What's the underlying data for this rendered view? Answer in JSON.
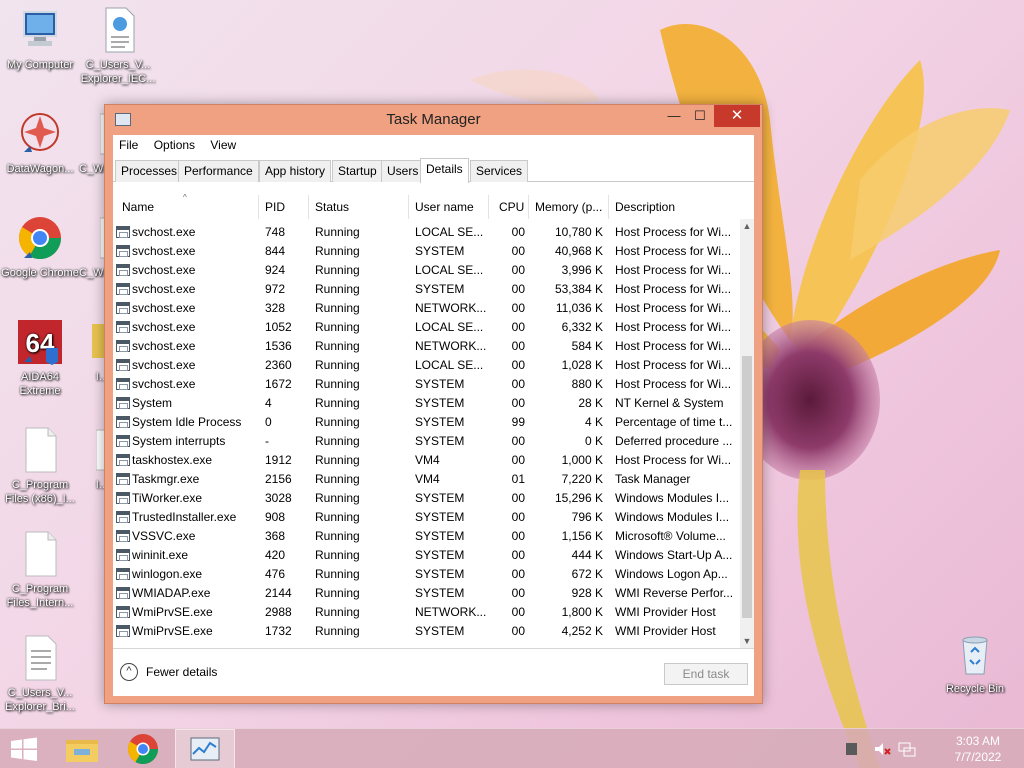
{
  "desktop": {
    "icons": [
      {
        "label": "My Computer"
      },
      {
        "label": "C_Users_V... Explorer_IEC..."
      },
      {
        "label": "DataWagon..."
      },
      {
        "label": "C_W..."
      },
      {
        "label": "Google Chrome"
      },
      {
        "label": "C_W..."
      },
      {
        "label": "AIDA64 Extreme"
      },
      {
        "label": "I..."
      },
      {
        "label": "C_Program Files (x86)_I..."
      },
      {
        "label": "I..."
      },
      {
        "label": "C_Program Files_Intern..."
      },
      {
        "label": "C_Users_V... Explorer_Bri..."
      },
      {
        "label": "Recycle Bin"
      }
    ]
  },
  "window": {
    "title": "Task Manager",
    "min_glyph": "—",
    "max_glyph": "☐",
    "close_glyph": "✕"
  },
  "menu": [
    "File",
    "Options",
    "View"
  ],
  "tabs": [
    "Processes",
    "Performance",
    "App history",
    "Startup",
    "Users",
    "Details",
    "Services"
  ],
  "active_tab": "Details",
  "columns": [
    "Name",
    "PID",
    "Status",
    "User name",
    "CPU",
    "Memory (p...",
    "Description"
  ],
  "rows": [
    {
      "name": "svchost.exe",
      "pid": "748",
      "status": "Running",
      "user": "LOCAL SE...",
      "cpu": "00",
      "mem": "10,780 K",
      "desc": "Host Process for Wi..."
    },
    {
      "name": "svchost.exe",
      "pid": "844",
      "status": "Running",
      "user": "SYSTEM",
      "cpu": "00",
      "mem": "40,968 K",
      "desc": "Host Process for Wi..."
    },
    {
      "name": "svchost.exe",
      "pid": "924",
      "status": "Running",
      "user": "LOCAL SE...",
      "cpu": "00",
      "mem": "3,996 K",
      "desc": "Host Process for Wi..."
    },
    {
      "name": "svchost.exe",
      "pid": "972",
      "status": "Running",
      "user": "SYSTEM",
      "cpu": "00",
      "mem": "53,384 K",
      "desc": "Host Process for Wi..."
    },
    {
      "name": "svchost.exe",
      "pid": "328",
      "status": "Running",
      "user": "NETWORK...",
      "cpu": "00",
      "mem": "11,036 K",
      "desc": "Host Process for Wi..."
    },
    {
      "name": "svchost.exe",
      "pid": "1052",
      "status": "Running",
      "user": "LOCAL SE...",
      "cpu": "00",
      "mem": "6,332 K",
      "desc": "Host Process for Wi..."
    },
    {
      "name": "svchost.exe",
      "pid": "1536",
      "status": "Running",
      "user": "NETWORK...",
      "cpu": "00",
      "mem": "584 K",
      "desc": "Host Process for Wi..."
    },
    {
      "name": "svchost.exe",
      "pid": "2360",
      "status": "Running",
      "user": "LOCAL SE...",
      "cpu": "00",
      "mem": "1,028 K",
      "desc": "Host Process for Wi..."
    },
    {
      "name": "svchost.exe",
      "pid": "1672",
      "status": "Running",
      "user": "SYSTEM",
      "cpu": "00",
      "mem": "880 K",
      "desc": "Host Process for Wi..."
    },
    {
      "name": "System",
      "pid": "4",
      "status": "Running",
      "user": "SYSTEM",
      "cpu": "00",
      "mem": "28 K",
      "desc": "NT Kernel & System"
    },
    {
      "name": "System Idle Process",
      "pid": "0",
      "status": "Running",
      "user": "SYSTEM",
      "cpu": "99",
      "mem": "4 K",
      "desc": "Percentage of time t..."
    },
    {
      "name": "System interrupts",
      "pid": "-",
      "status": "Running",
      "user": "SYSTEM",
      "cpu": "00",
      "mem": "0 K",
      "desc": "Deferred procedure ..."
    },
    {
      "name": "taskhostex.exe",
      "pid": "1912",
      "status": "Running",
      "user": "VM4",
      "cpu": "00",
      "mem": "1,000 K",
      "desc": "Host Process for Wi..."
    },
    {
      "name": "Taskmgr.exe",
      "pid": "2156",
      "status": "Running",
      "user": "VM4",
      "cpu": "01",
      "mem": "7,220 K",
      "desc": "Task Manager"
    },
    {
      "name": "TiWorker.exe",
      "pid": "3028",
      "status": "Running",
      "user": "SYSTEM",
      "cpu": "00",
      "mem": "15,296 K",
      "desc": "Windows Modules I..."
    },
    {
      "name": "TrustedInstaller.exe",
      "pid": "908",
      "status": "Running",
      "user": "SYSTEM",
      "cpu": "00",
      "mem": "796 K",
      "desc": "Windows Modules I..."
    },
    {
      "name": "VSSVC.exe",
      "pid": "368",
      "status": "Running",
      "user": "SYSTEM",
      "cpu": "00",
      "mem": "1,156 K",
      "desc": "Microsoft® Volume..."
    },
    {
      "name": "wininit.exe",
      "pid": "420",
      "status": "Running",
      "user": "SYSTEM",
      "cpu": "00",
      "mem": "444 K",
      "desc": "Windows Start-Up A..."
    },
    {
      "name": "winlogon.exe",
      "pid": "476",
      "status": "Running",
      "user": "SYSTEM",
      "cpu": "00",
      "mem": "672 K",
      "desc": "Windows Logon Ap..."
    },
    {
      "name": "WMIADAP.exe",
      "pid": "2144",
      "status": "Running",
      "user": "SYSTEM",
      "cpu": "00",
      "mem": "928 K",
      "desc": "WMI Reverse Perfor..."
    },
    {
      "name": "WmiPrvSE.exe",
      "pid": "2988",
      "status": "Running",
      "user": "NETWORK...",
      "cpu": "00",
      "mem": "1,800 K",
      "desc": "WMI Provider Host"
    },
    {
      "name": "WmiPrvSE.exe",
      "pid": "1732",
      "status": "Running",
      "user": "SYSTEM",
      "cpu": "00",
      "mem": "4,252 K",
      "desc": "WMI Provider Host"
    }
  ],
  "footer": {
    "fewer_details": "Fewer details",
    "end_task": "End task"
  },
  "taskbar": {
    "time": "3:03 AM",
    "date": "7/7/2022"
  },
  "colors": {
    "window_frame": "#f0a181",
    "close_button": "#c7392b"
  }
}
